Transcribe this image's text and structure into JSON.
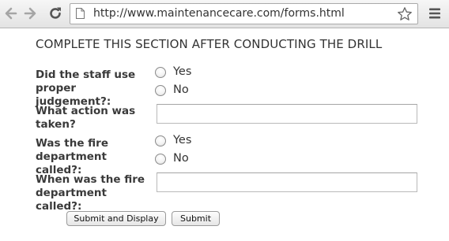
{
  "browser": {
    "url": "http://www.maintenancecare.com/forms.html",
    "icons": {
      "back": "back-arrow-icon",
      "forward": "forward-arrow-icon",
      "reload": "reload-icon",
      "page": "page-icon",
      "bookmark": "star-icon",
      "menu": "hamburger-menu-icon"
    }
  },
  "form": {
    "heading": "COMPLETE THIS SECTION AFTER CONDUCTING THE DRILL",
    "q1": {
      "label": "Did the staff use proper judgement?:",
      "options": [
        "Yes",
        "No"
      ]
    },
    "q2": {
      "label": "What action was taken?",
      "value": ""
    },
    "q3": {
      "label": "Was the fire department called?:",
      "options": [
        "Yes",
        "No"
      ]
    },
    "q4": {
      "label": "When was the fire department called?:",
      "value": ""
    },
    "buttons": {
      "submit_display": "Submit and Display",
      "submit": "Submit"
    }
  }
}
